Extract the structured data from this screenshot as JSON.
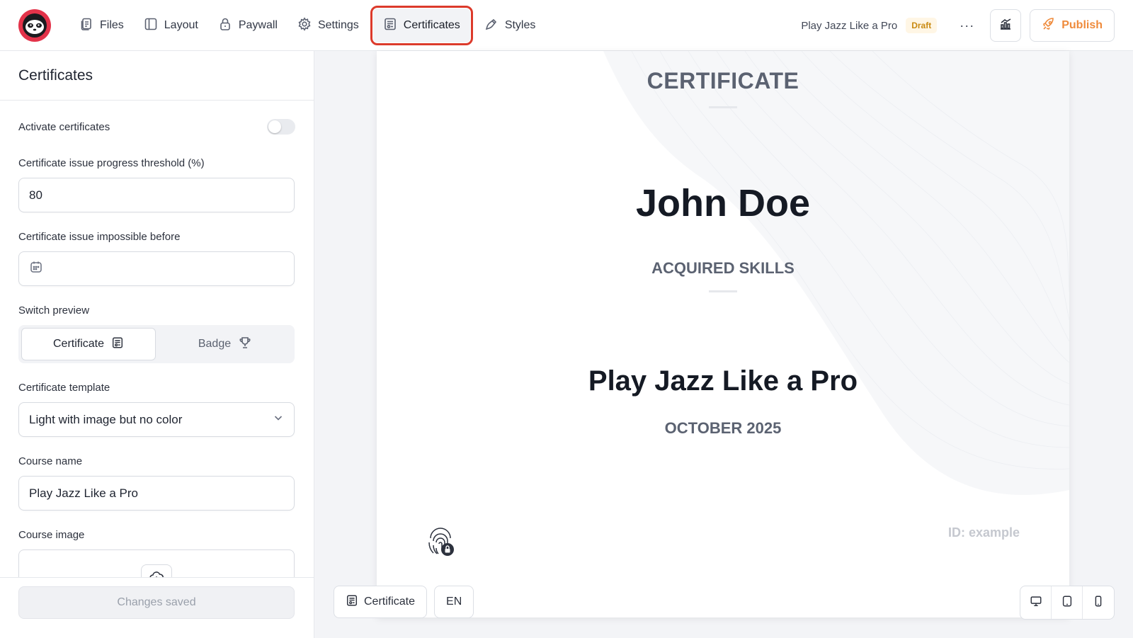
{
  "app": {
    "logo_icon": "sloth-logo-icon",
    "brand_color": "#e3334a"
  },
  "nav": {
    "items": [
      {
        "label": "Files",
        "icon": "files-icon"
      },
      {
        "label": "Layout",
        "icon": "layout-icon"
      },
      {
        "label": "Paywall",
        "icon": "lock-icon"
      },
      {
        "label": "Settings",
        "icon": "gear-icon"
      },
      {
        "label": "Certificates",
        "icon": "certificate-icon",
        "active": true
      },
      {
        "label": "Styles",
        "icon": "brush-icon"
      }
    ],
    "active_outline_color": "#dc3a2b"
  },
  "header": {
    "course_title": "Play Jazz Like a Pro",
    "status_badge": "Draft",
    "more": "···",
    "publish_label": "Publish",
    "publish_color": "#ef8b3c"
  },
  "panel": {
    "title": "Certificates",
    "activate_label": "Activate certificates",
    "activate_on": false,
    "threshold_label": "Certificate issue progress threshold (%)",
    "threshold_value": "80",
    "impossible_before_label": "Certificate issue impossible before",
    "impossible_before_value": "",
    "switch_preview_label": "Switch preview",
    "preview_options": [
      "Certificate",
      "Badge"
    ],
    "preview_selected": "Certificate",
    "template_label": "Certificate template",
    "template_value": "Light with image but no color",
    "course_name_label": "Course name",
    "course_name_value": "Play Jazz Like a Pro",
    "course_image_label": "Course image",
    "saved_label": "Changes saved"
  },
  "certificate": {
    "heading": "CERTIFICATE",
    "recipient": "John Doe",
    "skills_heading": "ACQUIRED SKILLS",
    "course": "Play Jazz Like a Pro",
    "date": "OCTOBER 2025",
    "id_text": "ID: example"
  },
  "preview_toolbar": {
    "mode_label": "Certificate",
    "language": "EN",
    "devices": [
      "desktop-icon",
      "tablet-icon",
      "mobile-icon"
    ]
  }
}
